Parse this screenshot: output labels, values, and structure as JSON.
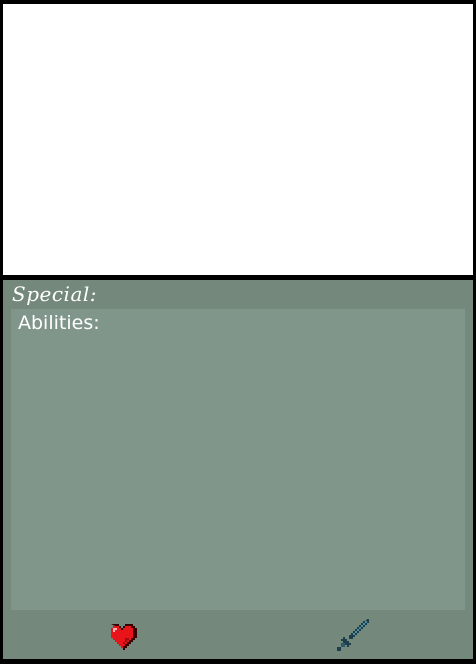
{
  "special_panel": {
    "title": "Special:",
    "abilities_label": "Abilities:"
  },
  "tabs": [
    {
      "icon": "heart-icon"
    },
    {
      "icon": "sword-icon"
    }
  ],
  "colors": {
    "top_screen": "#ffffff",
    "panel_bg": "#74897c",
    "inner_panel_bg": "#81968a",
    "text": "#ffffff",
    "heart": "#e8141a",
    "sword_blade": "#4a8fa6"
  }
}
